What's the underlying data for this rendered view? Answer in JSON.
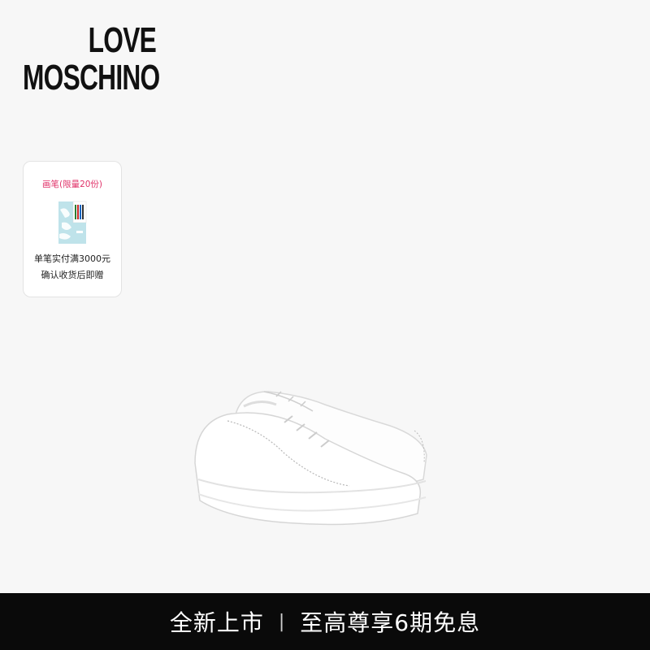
{
  "brand": {
    "line1": "LOVE",
    "line2": "MOSCHINO"
  },
  "gift": {
    "title": "画笔(限量20份)",
    "line1": "单笔实付满3000元",
    "line2": "确认收货后即赠",
    "title_color": "#e0336a"
  },
  "product": {
    "image": "white-leather-sneakers"
  },
  "promo": {
    "left": "全新上市",
    "right": "至高尊享6期免息",
    "separator": "|"
  }
}
